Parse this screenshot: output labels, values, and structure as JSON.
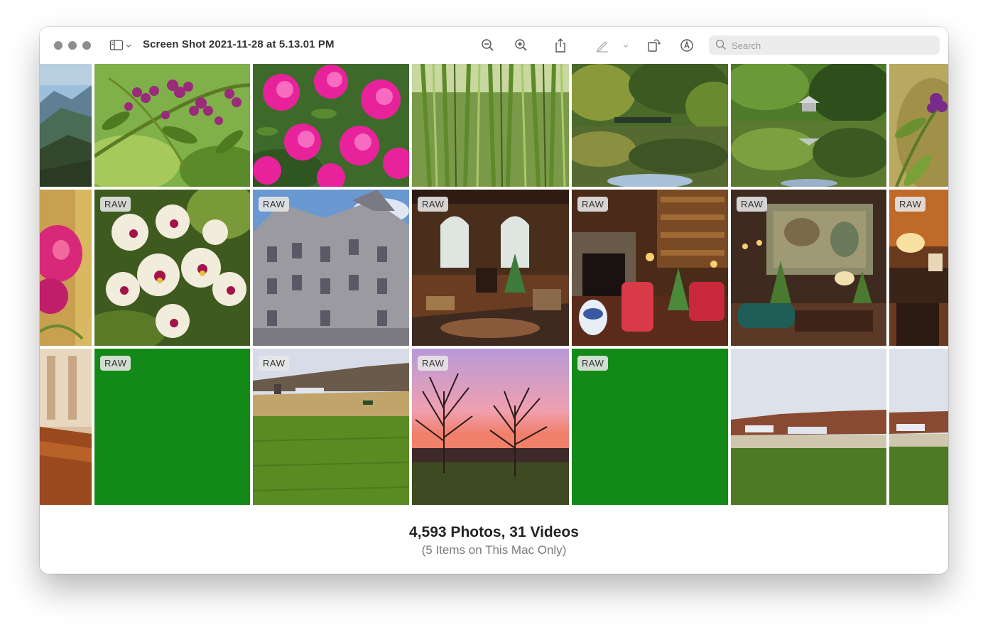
{
  "window": {
    "title": "Screen Shot 2021-11-28 at 5.13.01 PM"
  },
  "toolbar": {
    "icons": [
      "sidebar-icon",
      "zoom-out-icon",
      "zoom-in-icon",
      "share-icon",
      "markup-pen-icon",
      "chevron-down-icon",
      "rotate-icon",
      "annotate-icon"
    ],
    "search_placeholder": "Search"
  },
  "grid": {
    "rows": [
      [
        {
          "subject": "mountain-landscape",
          "raw": false
        },
        {
          "subject": "purple-berries",
          "raw": false
        },
        {
          "subject": "pink-azaleas",
          "raw": false
        },
        {
          "subject": "bamboo-forest",
          "raw": false
        },
        {
          "subject": "pond-reflection-bridge",
          "raw": false
        },
        {
          "subject": "pond-reflection-gazebo",
          "raw": false
        },
        {
          "subject": "purple-flower-closeup",
          "raw": false
        }
      ],
      [
        {
          "subject": "pink-orchid",
          "raw": false
        },
        {
          "subject": "white-orchids",
          "raw": true,
          "badge": "RAW"
        },
        {
          "subject": "castle-facade",
          "raw": true,
          "badge": "RAW"
        },
        {
          "subject": "mansion-interior",
          "raw": true,
          "badge": "RAW"
        },
        {
          "subject": "library-fireplace",
          "raw": true,
          "badge": "RAW"
        },
        {
          "subject": "tapestry-room",
          "raw": true,
          "badge": "RAW"
        },
        {
          "subject": "lamp-desk-room",
          "raw": true,
          "badge": "RAW"
        }
      ],
      [
        {
          "subject": "hallway-wood-floor",
          "raw": false
        },
        {
          "subject": "green-placeholder",
          "raw": true,
          "badge": "RAW"
        },
        {
          "subject": "farm-field",
          "raw": true,
          "badge": "RAW"
        },
        {
          "subject": "sunset-trees",
          "raw": true,
          "badge": "RAW"
        },
        {
          "subject": "green-placeholder",
          "raw": true,
          "badge": "RAW"
        },
        {
          "subject": "farm-field-wide",
          "raw": false
        },
        {
          "subject": "farm-field-edge",
          "raw": false
        }
      ]
    ]
  },
  "footer": {
    "count": "4,593 Photos, 31 Videos",
    "subtitle": "(5 Items on This Mac Only)"
  },
  "colors": {
    "placeholder_green": "#138a17",
    "traffic_light_gray": "#8e8e8e"
  }
}
